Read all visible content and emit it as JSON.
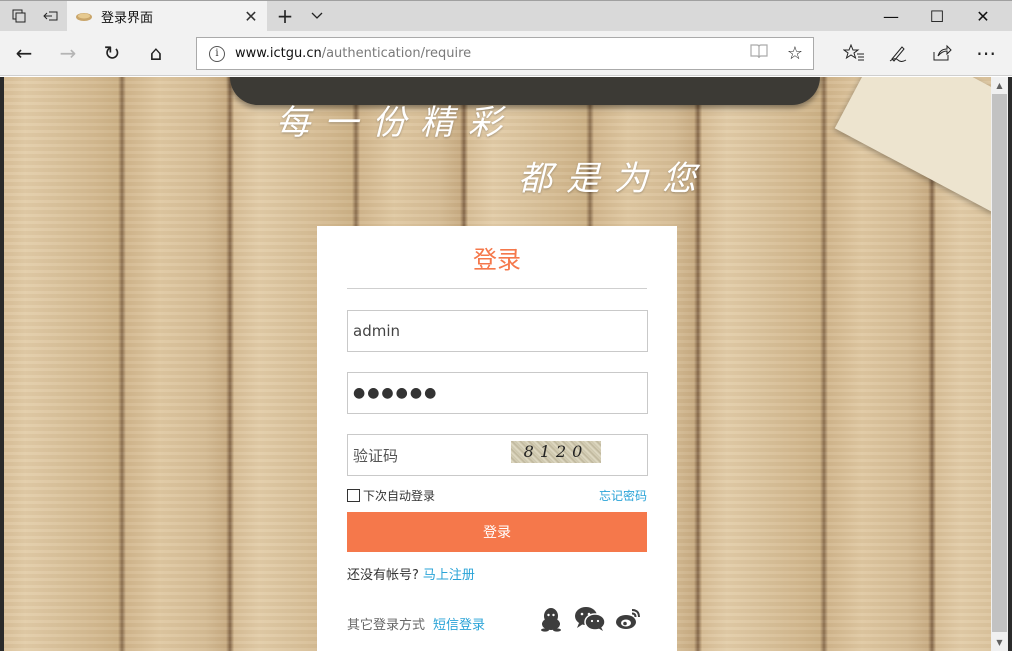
{
  "browser": {
    "tab": {
      "title": "登录界面",
      "favicon": "tab-favicon-icon",
      "close_glyph": "✕"
    },
    "new_tab_glyph": "+",
    "tab_list_glyph": "⌄",
    "window_controls": {
      "minimize": "—",
      "maximize": "☐",
      "close": "✕"
    },
    "address": {
      "host": "www.ictgu.cn",
      "path": "/authentication/require"
    },
    "icons": {
      "back": "←",
      "forward": "→",
      "refresh": "↻",
      "home": "⌂",
      "reader": "📖",
      "favorite": "☆",
      "favorites_hub": "☆≡",
      "notes": "✎",
      "share": "⇪",
      "more": "⋯"
    }
  },
  "page": {
    "slogan_line1": "每一份精彩",
    "slogan_line2": "都是为您",
    "login": {
      "title": "登录",
      "username_value": "admin",
      "password_mask": "●●●●●●",
      "captcha_placeholder": "验证码",
      "captcha_text": "8120",
      "remember_label": "下次自动登录",
      "forgot_link": "忘记密码",
      "submit_label": "登录",
      "no_account_text": "还没有帐号?",
      "register_link": "马上注册",
      "other_login_label": "其它登录方式",
      "sms_login_link": "短信登录",
      "social_icons": [
        "qq-icon",
        "wechat-icon",
        "weibo-icon"
      ]
    }
  },
  "colors": {
    "accent": "#f5784b",
    "link": "#29a3d7"
  }
}
